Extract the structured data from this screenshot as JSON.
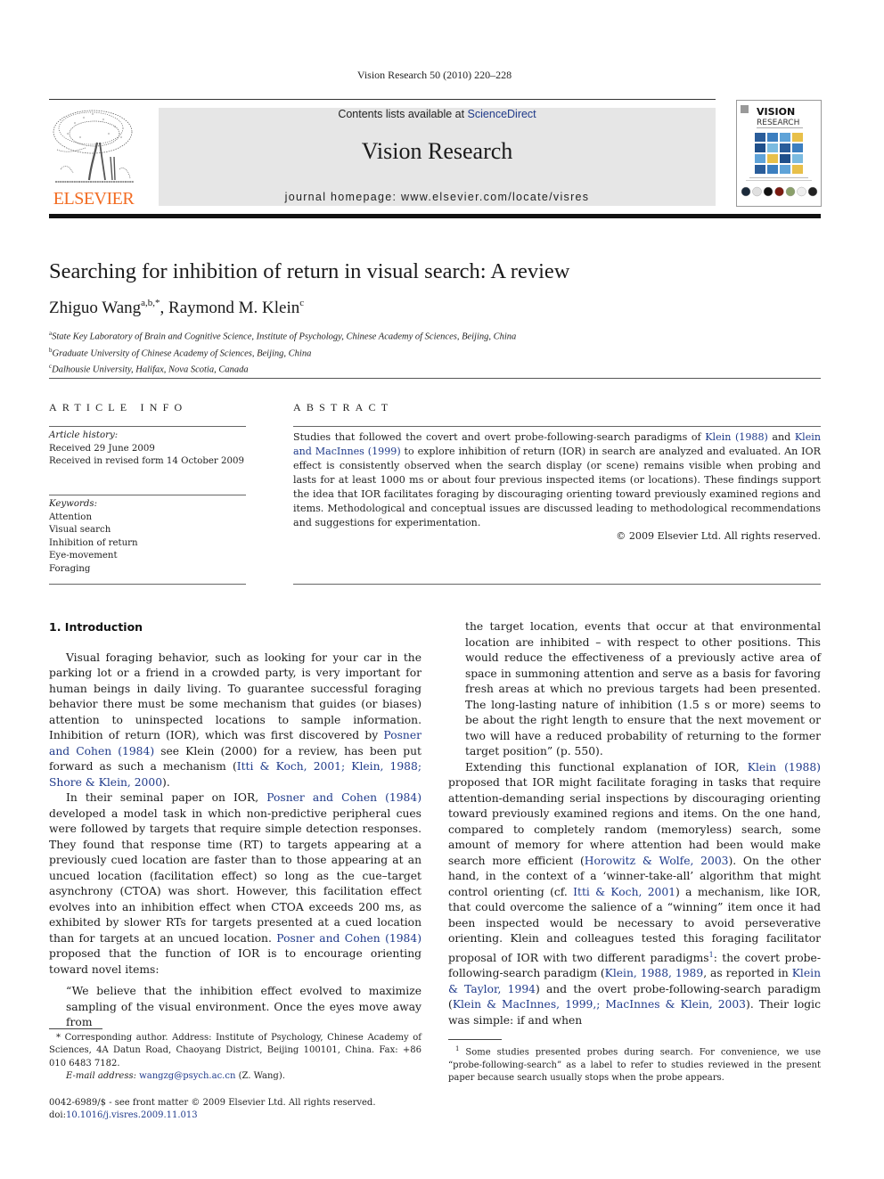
{
  "running_head": "Vision Research 50 (2010) 220–228",
  "publisher": {
    "logo_word": "ELSEVIER",
    "brand_color": "#f26b21"
  },
  "masthead": {
    "contents_prefix": "Contents lists available at ",
    "contents_link": "ScienceDirect",
    "journal_title": "Vision Research",
    "homepage": "journal homepage: www.elsevier.com/locate/visres"
  },
  "cover": {
    "title_line1": "VISION",
    "title_line2": "RESEARCH"
  },
  "article": {
    "title": "Searching for inhibition of return in visual search: A review",
    "authors": [
      {
        "name": "Zhiguo Wang",
        "marks": "a,b,*"
      },
      {
        "name": "Raymond M. Klein",
        "marks": "c"
      }
    ],
    "author_separator": ", ",
    "affiliations": [
      {
        "mark": "a",
        "text": "State Key Laboratory of Brain and Cognitive Science, Institute of Psychology, Chinese Academy of Sciences, Beijing, China"
      },
      {
        "mark": "b",
        "text": "Graduate University of Chinese Academy of Sciences, Beijing, China"
      },
      {
        "mark": "c",
        "text": "Dalhousie University, Halifax, Nova Scotia, Canada"
      }
    ]
  },
  "article_info": {
    "heading": "ARTICLE INFO",
    "history_label": "Article history:",
    "received": "Received 29 June 2009",
    "revised": "Received in revised form 14 October 2009",
    "keywords_label": "Keywords:",
    "keywords": [
      "Attention",
      "Visual search",
      "Inhibition of return",
      "Eye-movement",
      "Foraging"
    ]
  },
  "abstract": {
    "heading": "ABSTRACT",
    "parts": [
      {
        "t": "Studies that followed the covert and overt probe-following-search paradigms of "
      },
      {
        "t": "Klein (1988)",
        "link": true
      },
      {
        "t": " and "
      },
      {
        "t": "Klein and MacInnes (1999)",
        "link": true
      },
      {
        "t": " to explore inhibition of return (IOR) in search are analyzed and evaluated. An IOR effect is consistently observed when the search display (or scene) remains visible when probing and lasts for at least 1000 ms or about four previous inspected items (or locations). These findings support the idea that IOR facilitates foraging by discouraging orienting toward previously examined regions and items. Methodological and conceptual issues are discussed leading to methodological recommendations and suggestions for experimentation."
      }
    ],
    "copyright": "© 2009 Elsevier Ltd. All rights reserved."
  },
  "body": {
    "section_heading": "1. Introduction",
    "left_paragraphs": [
      [
        {
          "t": "Visual foraging behavior, such as looking for your car in the parking lot or a friend in a crowded party, is very important for human beings in daily living. To guarantee successful foraging behavior there must be some mechanism that guides (or biases) attention to uninspected locations to sample information. Inhibition of return (IOR), which was first discovered by "
        },
        {
          "t": "Posner and Cohen (1984)",
          "link": true
        },
        {
          "t": " see Klein (2000) for a review, has been put forward as such a mechanism ("
        },
        {
          "t": "Itti & Koch, 2001; Klein, 1988; Shore & Klein, 2000",
          "link": true
        },
        {
          "t": ")."
        }
      ],
      [
        {
          "t": "In their seminal paper on IOR, "
        },
        {
          "t": "Posner and Cohen (1984)",
          "link": true
        },
        {
          "t": " developed a model task in which non-predictive peripheral cues were followed by targets that require simple detection responses. They found that response time (RT) to targets appearing at a previously cued location are faster than to those appearing at an uncued location (facilitation effect) so long as the cue–target asynchrony (CTOA) was short. However, this facilitation effect evolves into an inhibition effect when CTOA exceeds 200 ms, as exhibited by slower RTs for targets presented at a cued location than for targets at an uncued location. "
        },
        {
          "t": "Posner and Cohen (1984)",
          "link": true
        },
        {
          "t": " proposed that the function of IOR is to encourage orienting toward novel items:"
        }
      ]
    ],
    "quote_start": "“We believe that the inhibition effect evolved to maximize sampling of the visual environment. Once the eyes move away from",
    "quote_end": "the target location, events that occur at that environmental location are inhibited – with respect to other positions. This would reduce the effectiveness of a previously active area of space in summoning attention and serve as a basis for favoring fresh areas at which no previous targets had been presented. The long-lasting nature of inhibition (1.5 s or more) seems to be about the right length to ensure that the next movement or two will have a reduced probability of returning to the former target position” (p. 550).",
    "right_paragraph": [
      {
        "t": "Extending this functional explanation of IOR, "
      },
      {
        "t": "Klein (1988)",
        "link": true
      },
      {
        "t": " proposed that IOR might facilitate foraging in tasks that require attention-demanding serial inspections by discouraging orienting toward previously examined regions and items. On the one hand, compared to completely random (memoryless) search, some amount of memory for where attention had been would make search more efficient ("
      },
      {
        "t": "Horowitz & Wolfe, 2003",
        "link": true
      },
      {
        "t": "). On the other hand, in the context of a ‘winner-take-all’ algorithm that might control orienting (cf. "
      },
      {
        "t": "Itti & Koch, 2001",
        "link": true
      },
      {
        "t": ") a mechanism, like IOR, that could overcome the salience of a “winning” item once it had been inspected would be necessary to avoid perseverative orienting. Klein and colleagues tested this foraging facilitator proposal of IOR with two different paradigms"
      },
      {
        "t": "1",
        "sup": true
      },
      {
        "t": ": the covert probe-following-search paradigm ("
      },
      {
        "t": "Klein, 1988, 1989",
        "link": true
      },
      {
        "t": ", as reported in "
      },
      {
        "t": "Klein & Taylor, 1994",
        "link": true
      },
      {
        "t": ") and the overt probe-following-search paradigm ("
      },
      {
        "t": "Klein & MacInnes, 1999,; MacInnes & Klein, 2003",
        "link": true
      },
      {
        "t": "). Their logic was simple: if and when"
      }
    ]
  },
  "footnotes": {
    "corresponding": "* Corresponding author. Address: Institute of Psychology, Chinese Academy of Sciences, 4A Datun Road, Chaoyang District, Beijing 100101, China. Fax: +86 010 6483 7182.",
    "email_label": "E-mail address: ",
    "email": "wangzg@psych.ac.cn",
    "email_suffix": " (Z. Wang).",
    "note1_mark": "1",
    "note1": "Some studies presented probes during search. For convenience, we use “probe-following-search” as a label to refer to studies reviewed in the present paper because search usually stops when the probe appears."
  },
  "front_matter": {
    "issn_line": "0042-6989/$ - see front matter © 2009 Elsevier Ltd. All rights reserved.",
    "doi_prefix": "doi:",
    "doi": "10.1016/j.visres.2009.11.013"
  }
}
